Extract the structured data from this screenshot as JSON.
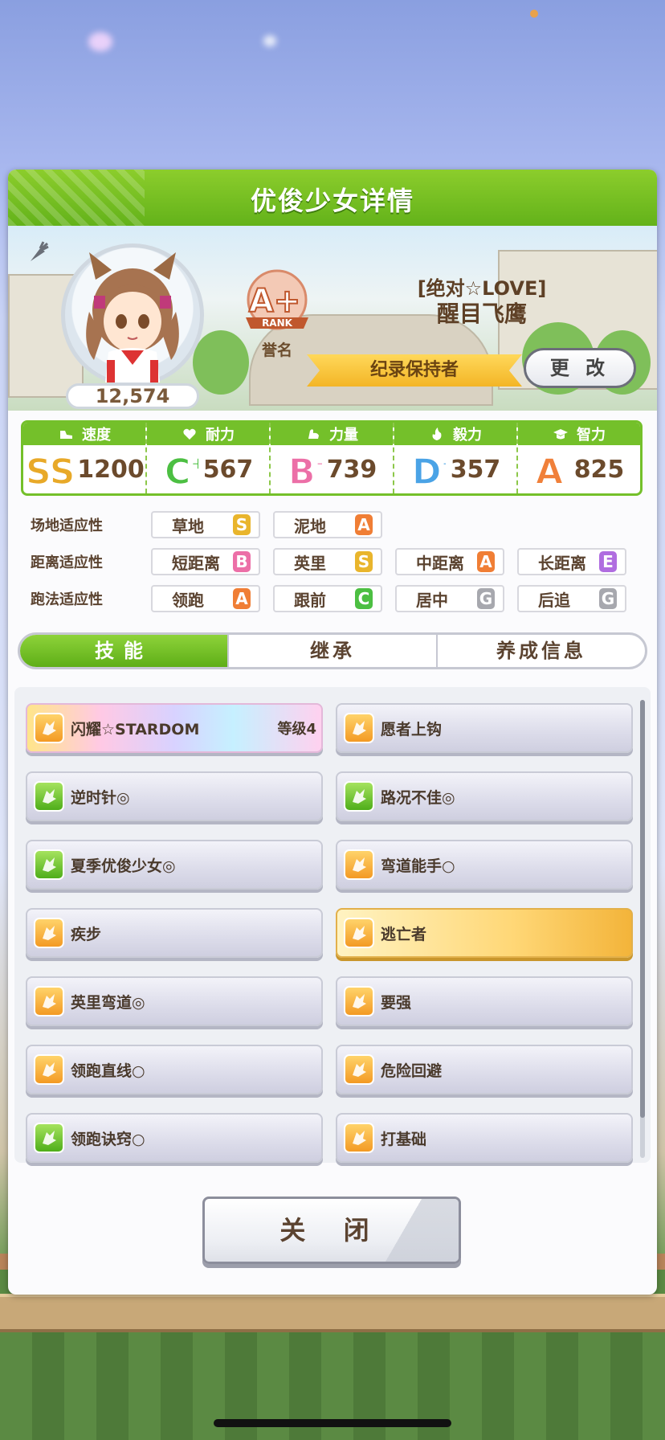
{
  "dialog": {
    "title": "优俊少女详情",
    "close_label": "关 闭"
  },
  "profile": {
    "score": "12,574",
    "rank": "A+",
    "rank_word": "RANK",
    "rank_caption": "誉名",
    "epithet": "[绝对☆LOVE]",
    "name": "醒目飞鹰",
    "title_ribbon": "纪录保持者",
    "change_label": "更 改"
  },
  "stats": [
    {
      "label": "速度",
      "icon": "shoe-icon",
      "grade": "SS",
      "value": "1200",
      "color": "#e8a928"
    },
    {
      "label": "耐力",
      "icon": "heart-icon",
      "grade": "C+",
      "value": "567",
      "color": "#4cbf42"
    },
    {
      "label": "力量",
      "icon": "muscle-icon",
      "grade": "B+",
      "value": "739",
      "color": "#ec6fa7"
    },
    {
      "label": "毅力",
      "icon": "flame-icon",
      "grade": "D+",
      "value": "357",
      "color": "#4aa3e6"
    },
    {
      "label": "智力",
      "icon": "grad-cap-icon",
      "grade": "A",
      "value": "825",
      "color": "#f0803a"
    }
  ],
  "aptitude": {
    "track_label": "场地适应性",
    "distance_label": "距离适应性",
    "style_label": "跑法适应性",
    "track": [
      {
        "name": "草地",
        "grade": "S"
      },
      {
        "name": "泥地",
        "grade": "A"
      }
    ],
    "distance": [
      {
        "name": "短距离",
        "grade": "B"
      },
      {
        "name": "英里",
        "grade": "S"
      },
      {
        "name": "中距离",
        "grade": "A"
      },
      {
        "name": "长距离",
        "grade": "E"
      }
    ],
    "style": [
      {
        "name": "领跑",
        "grade": "A"
      },
      {
        "name": "跟前",
        "grade": "C"
      },
      {
        "name": "居中",
        "grade": "G"
      },
      {
        "name": "后追",
        "grade": "G"
      }
    ],
    "grade_colors": {
      "S": "#e9b52c",
      "A": "#f07e35",
      "B": "#ec6fa7",
      "C": "#4cbf42",
      "E": "#b06de0",
      "G": "#a7a8ae"
    }
  },
  "tabs": [
    "技能",
    "继承",
    "养成信息"
  ],
  "skills": [
    {
      "name": "闪耀☆STARDOM",
      "level": "等级4",
      "icon": "orange",
      "style": "rainbow"
    },
    {
      "name": "愿者上钩",
      "level": "",
      "icon": "orange",
      "style": "normal"
    },
    {
      "name": "逆时针◎",
      "level": "",
      "icon": "green",
      "style": "normal"
    },
    {
      "name": "路况不佳◎",
      "level": "",
      "icon": "green",
      "style": "normal"
    },
    {
      "name": "夏季优俊少女◎",
      "level": "",
      "icon": "green",
      "style": "normal"
    },
    {
      "name": "弯道能手○",
      "level": "",
      "icon": "orange",
      "style": "normal"
    },
    {
      "name": "疾步",
      "level": "",
      "icon": "orange",
      "style": "normal"
    },
    {
      "name": "逃亡者",
      "level": "",
      "icon": "orange",
      "style": "gold"
    },
    {
      "name": "英里弯道◎",
      "level": "",
      "icon": "orange",
      "style": "normal"
    },
    {
      "name": "要强",
      "level": "",
      "icon": "orange",
      "style": "normal"
    },
    {
      "name": "领跑直线○",
      "level": "",
      "icon": "orange",
      "style": "normal"
    },
    {
      "name": "危险回避",
      "level": "",
      "icon": "orange",
      "style": "normal"
    },
    {
      "name": "领跑诀窍○",
      "level": "",
      "icon": "green",
      "style": "normal"
    },
    {
      "name": "打基础",
      "level": "",
      "icon": "orange",
      "style": "normal"
    }
  ]
}
